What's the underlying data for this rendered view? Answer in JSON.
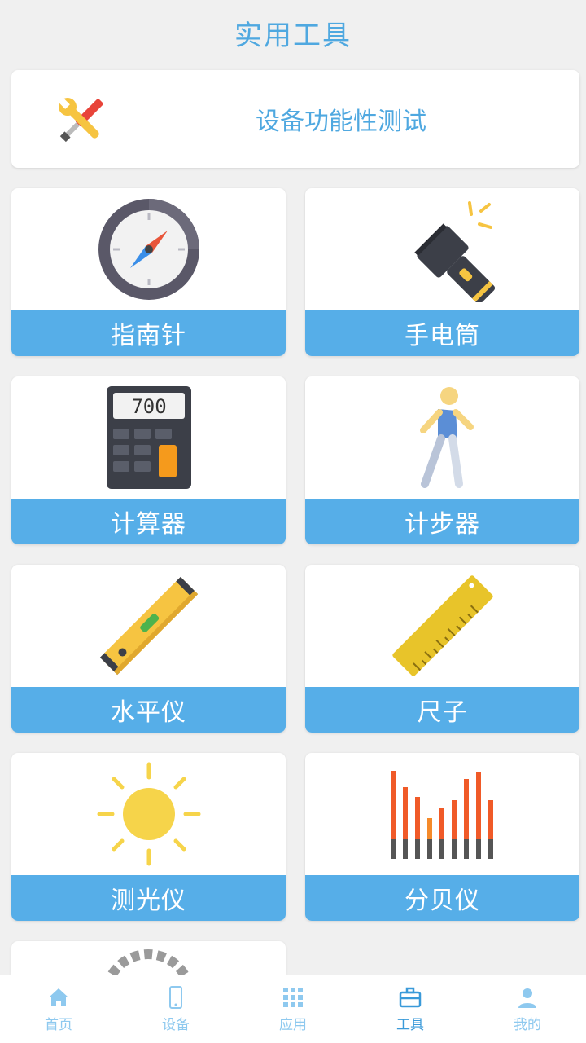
{
  "header": {
    "title": "实用工具"
  },
  "banner": {
    "label": "设备功能性测试",
    "icon": "tools-icon"
  },
  "tools": [
    {
      "label": "指南针",
      "icon": "compass-icon"
    },
    {
      "label": "手电筒",
      "icon": "flashlight-icon"
    },
    {
      "label": "计算器",
      "icon": "calculator-icon",
      "display": "700"
    },
    {
      "label": "计步器",
      "icon": "walker-icon"
    },
    {
      "label": "水平仪",
      "icon": "spirit-level-icon"
    },
    {
      "label": "尺子",
      "icon": "ruler-icon"
    },
    {
      "label": "测光仪",
      "icon": "sun-icon"
    },
    {
      "label": "分贝仪",
      "icon": "sound-bars-icon"
    }
  ],
  "tabbar": {
    "items": [
      {
        "label": "首页",
        "icon": "home-icon"
      },
      {
        "label": "设备",
        "icon": "phone-icon"
      },
      {
        "label": "应用",
        "icon": "apps-grid-icon"
      },
      {
        "label": "工具",
        "icon": "toolbox-icon",
        "active": true
      },
      {
        "label": "我的",
        "icon": "user-icon"
      }
    ]
  },
  "colors": {
    "accent": "#56aee8",
    "title": "#4fa8e0",
    "background": "#f0f0f0"
  }
}
